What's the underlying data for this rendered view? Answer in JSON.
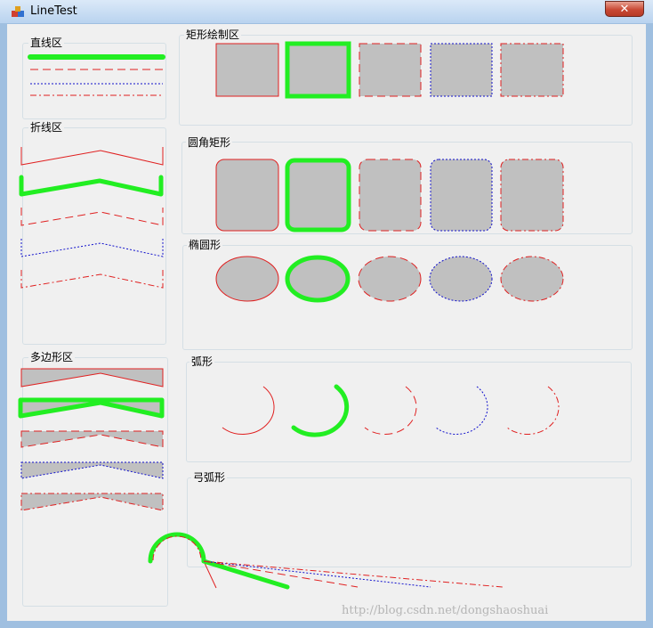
{
  "window": {
    "title": "LineTest",
    "close_glyph": "✕"
  },
  "groups": {
    "line": "直线区",
    "polyline": "折线区",
    "polygon": "多边形区",
    "rect": "矩形绘制区",
    "roundrect": "圆角矩形",
    "ellipse": "椭圆形",
    "arc": "弧形",
    "chord": "弓弧形"
  },
  "watermark": "http://blog.csdn.net/dongshaoshuai",
  "colors": {
    "red": "#e02020",
    "green": "#22ee22",
    "blue": "#1010cc",
    "fill": "#c0c0c0",
    "chrome": "#9fbfe0"
  },
  "pen_styles": [
    "solid-thin-red",
    "solid-thick-green",
    "dash-red",
    "dot-blue",
    "dashdot-red"
  ]
}
